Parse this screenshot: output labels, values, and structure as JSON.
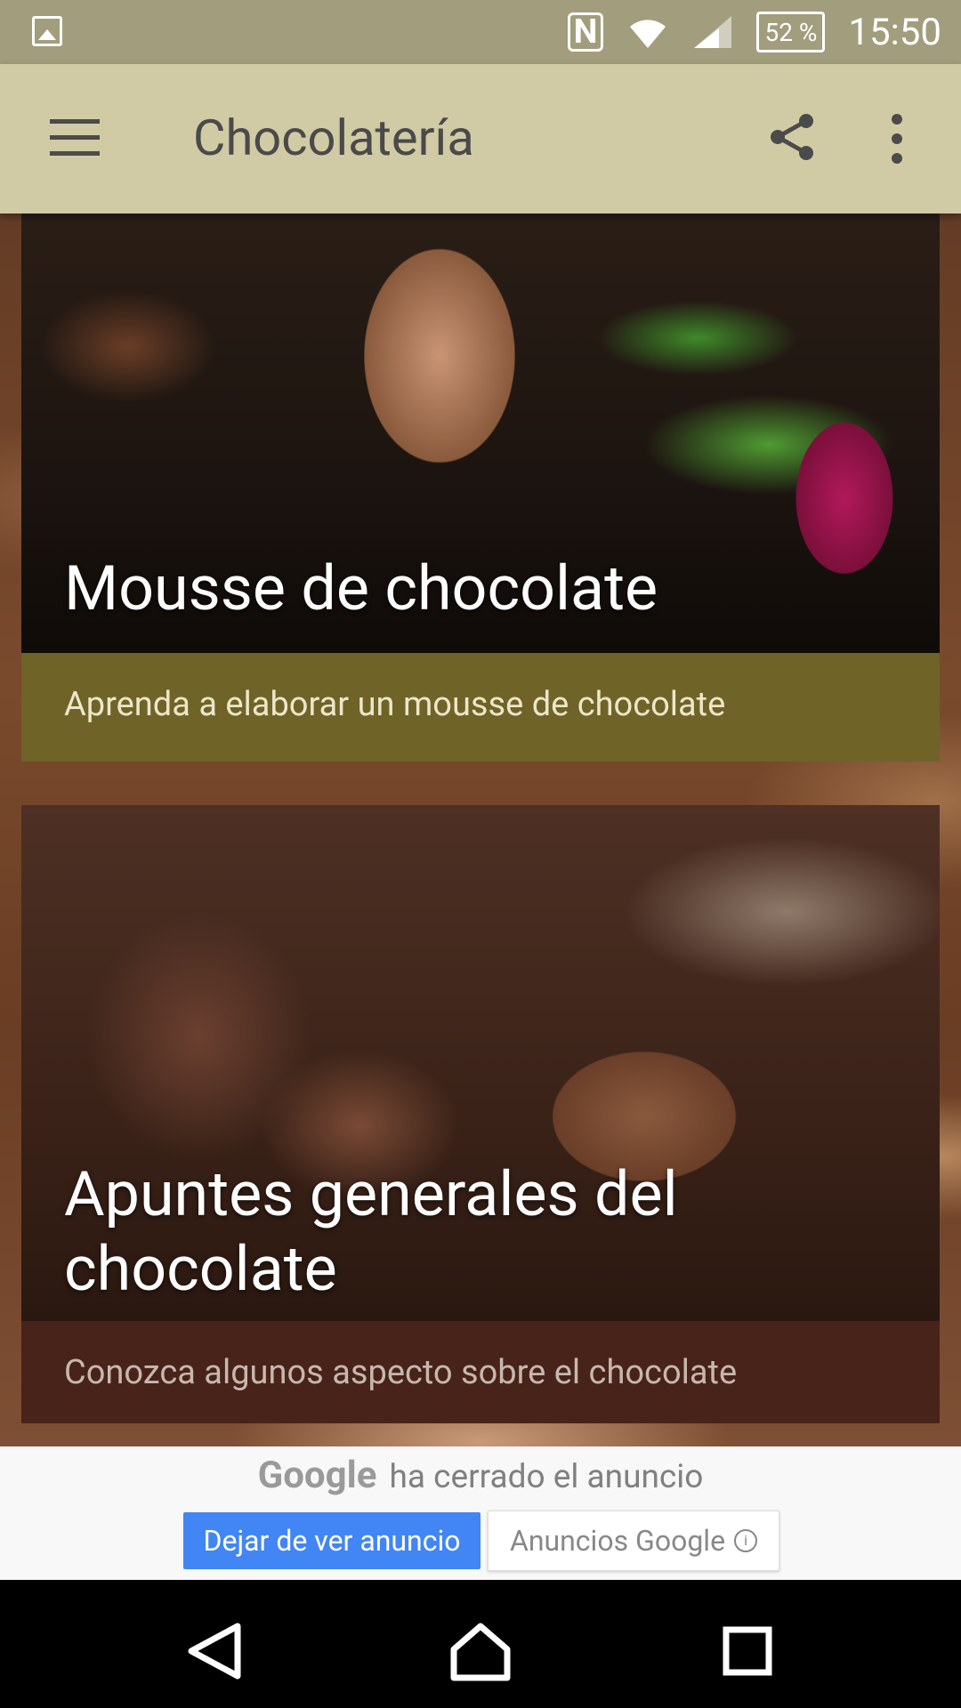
{
  "status_bar": {
    "battery": "52 %",
    "time": "15:50",
    "icons": [
      "gallery-icon",
      "nfc-icon",
      "wifi-icon",
      "signal-icon",
      "battery-icon"
    ]
  },
  "app_bar": {
    "title": "Chocolatería",
    "icons": [
      "menu-icon",
      "share-icon",
      "more-icon"
    ]
  },
  "cards": [
    {
      "title": "Mousse de chocolate",
      "description": "Aprenda a elaborar un mousse de chocolate"
    },
    {
      "title": "Apuntes generales del chocolate",
      "description": "Conozca algunos aspecto sobre el chocolate"
    }
  ],
  "ad": {
    "logo": "Google",
    "closed_text": "ha cerrado el anuncio",
    "stop_button": "Dejar de ver anuncio",
    "ads_button": "Anuncios Google"
  },
  "nav_bar": {
    "icons": [
      "back-icon",
      "home-icon",
      "recents-icon"
    ]
  },
  "colors": {
    "status_bar": "#a29d7c",
    "app_bar": "#d1cba5",
    "card1_footer": "#6f6328",
    "card2_footer": "#48231a",
    "ad_blue": "#4285f4"
  }
}
